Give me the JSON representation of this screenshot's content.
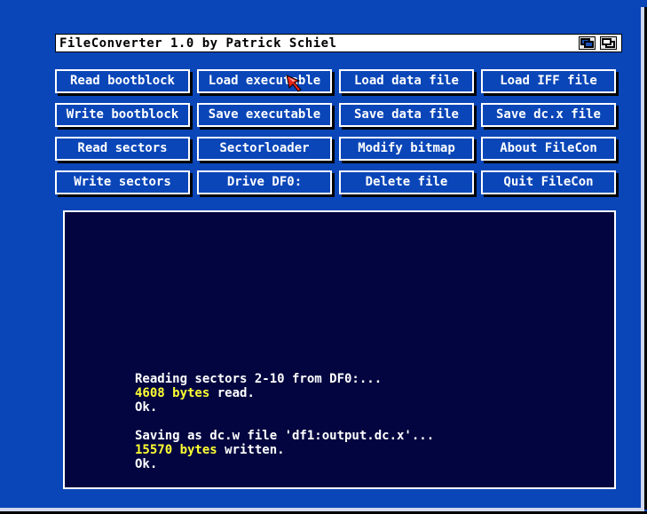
{
  "window": {
    "title": "FileConverter 1.0 by Patrick Schiel"
  },
  "colors": {
    "background": "#0a46b8",
    "panel": "#02053f",
    "text": "#ffffff",
    "highlight": "#ffff33"
  },
  "icons": {
    "depth_back": "window-back-icon",
    "depth_front": "window-front-icon",
    "pointer": "mouse-pointer-icon"
  },
  "buttons": {
    "read_bootblock": "Read bootblock",
    "load_executable": "Load executable",
    "load_data_file": "Load data file",
    "load_iff_file": "Load IFF file",
    "write_bootblock": "Write bootblock",
    "save_executable": "Save executable",
    "save_data_file": "Save data file",
    "save_dcx_file": "Save dc.x file",
    "read_sectors": "Read sectors",
    "sectorloader": "Sectorloader",
    "modify_bitmap": "Modify bitmap",
    "about": "About FileCon",
    "write_sectors": "Write sectors",
    "drive": "Drive DF0:",
    "delete_file": "Delete file",
    "quit": "Quit FileCon"
  },
  "output": {
    "line1": "Reading sectors 2-10 from DF0:...",
    "line2_value": "4608 bytes",
    "line2_rest": " read.",
    "line3": "Ok.",
    "line4": "Saving as dc.w file 'df1:output.dc.x'...",
    "line5_value": "15570 bytes",
    "line5_rest": " written.",
    "line6": "Ok."
  }
}
